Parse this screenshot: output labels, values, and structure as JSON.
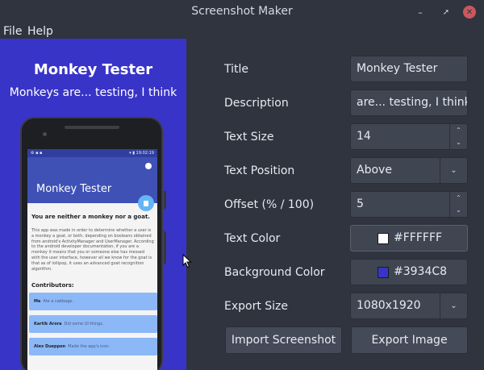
{
  "window": {
    "title": "Screenshot Maker"
  },
  "menu": {
    "file": "File",
    "help": "Help"
  },
  "preview": {
    "title": "Monkey Tester",
    "description": "Monkeys are... testing, I think",
    "background": "#3934C8",
    "phone": {
      "status_left": "⚙ ▪ ▪",
      "status_right": "▾ ▮ 19:02:19",
      "app_title": "Monkey Tester",
      "heading": "You are neither a monkey nor a goat.",
      "body": "This app was made in order to determine whether a user is a monkey a goat, or both, depending on booleans obtained from android's ActivityManager and UserManager. According to the android developer documentation, if you are a monkey it means that you or someone else has messed with the user interface, however all we know for the goat is that as of lollipop, it uses an advanced goat recognition algorithm.",
      "contributors_label": "Contributors:",
      "contributors": [
        {
          "name": "Me",
          "note": "Ate a cabbage."
        },
        {
          "name": "Kartik Arora",
          "note": "Did some UI things."
        },
        {
          "name": "Alex Dueppen",
          "note": "Made the app's icon."
        }
      ]
    }
  },
  "form": {
    "title": {
      "label": "Title",
      "value": "Monkey Tester"
    },
    "description": {
      "label": "Description",
      "value": "are... testing, I think"
    },
    "text_size": {
      "label": "Text Size",
      "value": "14"
    },
    "text_position": {
      "label": "Text Position",
      "value": "Above"
    },
    "offset": {
      "label": "Offset (% / 100)",
      "value": "5"
    },
    "text_color": {
      "label": "Text Color",
      "value": "#FFFFFF",
      "swatch": "#FFFFFF"
    },
    "background_color": {
      "label": "Background Color",
      "value": "#3934C8",
      "swatch": "#3934C8"
    },
    "export_size": {
      "label": "Export Size",
      "value": "1080x1920"
    },
    "import_button": "Import Screenshot",
    "export_button": "Export Image"
  },
  "icons": {
    "minimize": "minimize-icon",
    "maximize": "maximize-icon",
    "close": "close-icon",
    "spin_up": "chevron-up-icon",
    "spin_down": "chevron-down-icon",
    "dropdown": "chevron-down-icon",
    "cursor": "mouse-cursor-icon"
  }
}
